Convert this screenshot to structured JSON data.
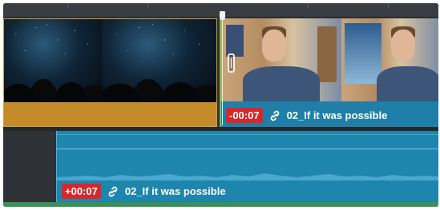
{
  "video_track": {
    "clip_a": {
      "thumbnail": "night-sky-trees"
    },
    "clip_b": {
      "trim_offset": "-00:07",
      "link_icon": "link-icon",
      "name": "02_If it was possible",
      "thumbnail": "man-in-office"
    }
  },
  "audio_track": {
    "clip": {
      "trim_offset": "+00:07",
      "link_icon": "link-icon",
      "name": "02_If it was possible"
    }
  },
  "colors": {
    "video_clip_a": "#c48b2a",
    "video_clip_b": "#1f7fa8",
    "audio_clip": "#1e85ad",
    "timecode_badge": "#d9262b",
    "edit_point": "#7dc242"
  }
}
